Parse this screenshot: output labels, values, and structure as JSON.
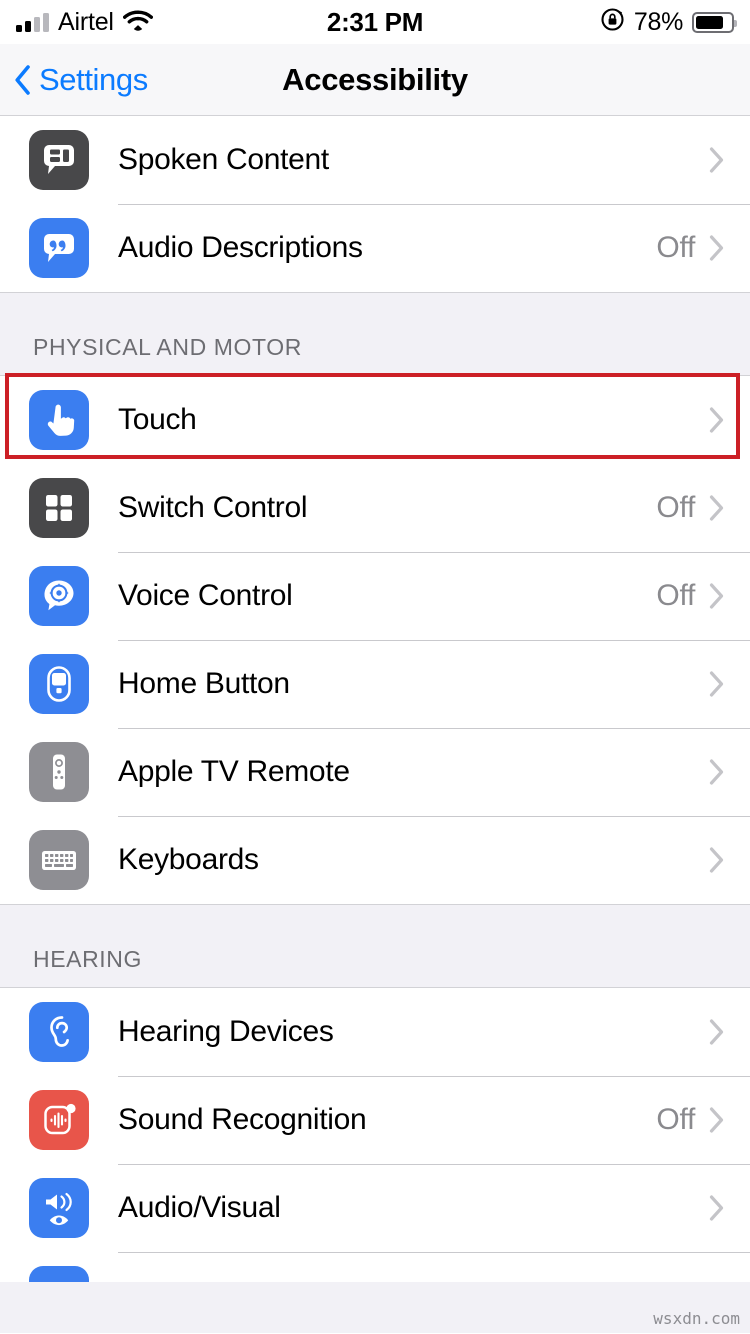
{
  "status_bar": {
    "carrier": "Airtel",
    "signal_bars_filled": 2,
    "signal_bars_total": 4,
    "wifi_icon": "wifi-icon",
    "time": "2:31 PM",
    "rotation_lock_icon": "rotation-lock-icon",
    "battery_percent_label": "78%",
    "battery_level": 78
  },
  "nav_bar": {
    "back_label": "Settings",
    "back_icon": "chevron-left-icon",
    "title": "Accessibility",
    "accent_color": "#0b7bff"
  },
  "colors": {
    "group_background": "#ffffff",
    "page_background": "#f2f1f6",
    "separator": "#c9c9cd",
    "secondary_text": "#8a8a8e",
    "header_text": "#6d6d72",
    "highlight": "#cc1f26",
    "icon_blue": "#3b7ef0",
    "icon_dark_gray": "#48484a",
    "icon_mid_gray": "#8e8e93",
    "icon_red": "#e8554a"
  },
  "sections": [
    {
      "header": "",
      "rows": [
        {
          "label": "Spoken Content",
          "value": "",
          "icon": "spoken-content-icon",
          "icon_style": "dark-gray",
          "chevron": true
        },
        {
          "label": "Audio Descriptions",
          "value": "Off",
          "icon": "audio-descriptions-icon",
          "icon_style": "blue",
          "chevron": true
        }
      ]
    },
    {
      "header": "PHYSICAL AND MOTOR",
      "rows": [
        {
          "label": "Touch",
          "value": "",
          "icon": "touch-icon",
          "icon_style": "blue",
          "chevron": true,
          "highlighted": true
        },
        {
          "label": "Switch Control",
          "value": "Off",
          "icon": "switch-control-icon",
          "icon_style": "dark-gray",
          "chevron": true
        },
        {
          "label": "Voice Control",
          "value": "Off",
          "icon": "voice-control-icon",
          "icon_style": "blue",
          "chevron": true
        },
        {
          "label": "Home Button",
          "value": "",
          "icon": "home-button-icon",
          "icon_style": "blue",
          "chevron": true
        },
        {
          "label": "Apple TV Remote",
          "value": "",
          "icon": "apple-tv-remote-icon",
          "icon_style": "mid-gray",
          "chevron": true
        },
        {
          "label": "Keyboards",
          "value": "",
          "icon": "keyboard-icon",
          "icon_style": "mid-gray",
          "chevron": true
        }
      ]
    },
    {
      "header": "HEARING",
      "rows": [
        {
          "label": "Hearing Devices",
          "value": "",
          "icon": "hearing-devices-icon",
          "icon_style": "blue",
          "chevron": true
        },
        {
          "label": "Sound Recognition",
          "value": "Off",
          "icon": "sound-recognition-icon",
          "icon_style": "red",
          "chevron": true
        },
        {
          "label": "Audio/Visual",
          "value": "",
          "icon": "audio-visual-icon",
          "icon_style": "blue",
          "chevron": true
        }
      ]
    }
  ],
  "watermark": "wsxdn.com"
}
